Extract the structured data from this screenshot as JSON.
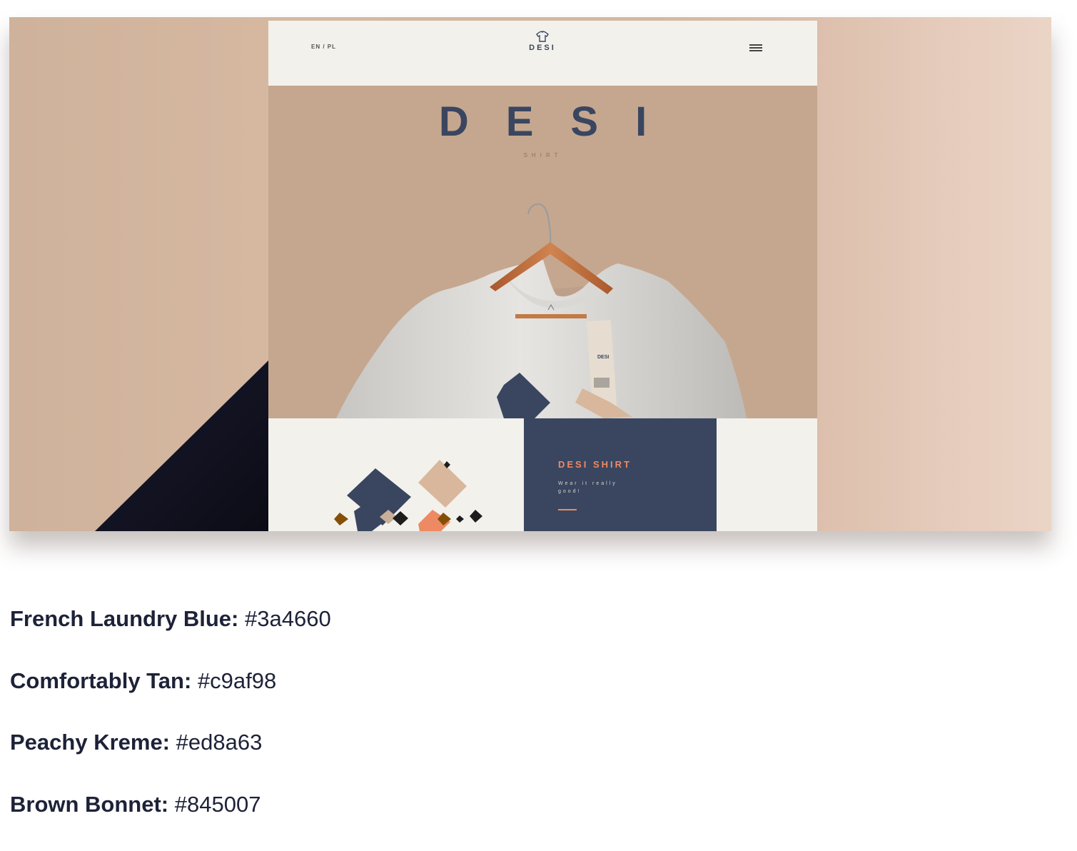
{
  "mockup": {
    "header": {
      "lang": "EN / PL",
      "brand": "DESI"
    },
    "hero": {
      "title": "DESI",
      "subtitle": "SHIRT",
      "tag_brand": "DESI"
    },
    "panel": {
      "title": "DESI SHIRT",
      "tagline": "Wear it really good!"
    }
  },
  "palette": [
    {
      "name": "French Laundry Blue:",
      "hex": "#3a4660"
    },
    {
      "name": "Comfortably Tan:",
      "hex": "#c9af98"
    },
    {
      "name": "Peachy Kreme:",
      "hex": "#ed8a63"
    },
    {
      "name": "Brown Bonnet:",
      "hex": "#845007"
    }
  ],
  "colors": {
    "navy": "#3a4660",
    "tan": "#c9af98",
    "peach": "#ed8a63",
    "brown": "#845007"
  }
}
